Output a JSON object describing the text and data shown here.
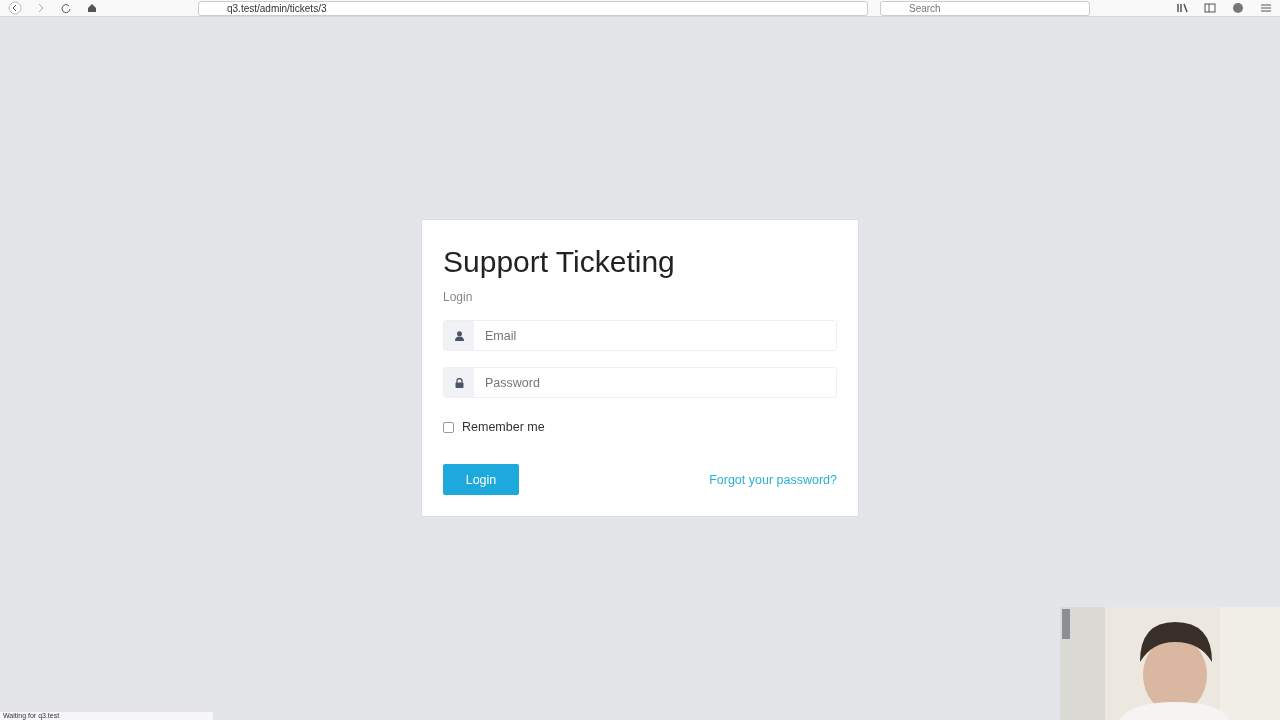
{
  "browser": {
    "url": "q3.test/admin/tickets/3",
    "search": {
      "placeholder": "Search"
    }
  },
  "login_card": {
    "title": "Support Ticketing",
    "subtitle": "Login",
    "email": {
      "placeholder": "Email"
    },
    "password": {
      "placeholder": "Password"
    },
    "remember": {
      "label": "Remember me",
      "checked": false
    },
    "button": "Login",
    "forgot_link": "Forgot your password?"
  },
  "status_bar": "Waiting for q3.test"
}
